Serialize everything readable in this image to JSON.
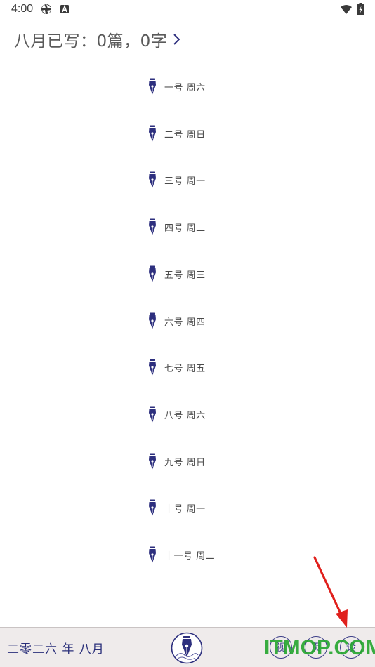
{
  "status_bar": {
    "time": "4:00",
    "icons": [
      "aperture-icon",
      "a-badge-icon",
      "wifi-icon",
      "battery-icon"
    ]
  },
  "header": {
    "title": "八月已写：0篇，0字",
    "chevron": "chevron-right-icon"
  },
  "days": [
    {
      "label": "一号 周六"
    },
    {
      "label": "二号 周日"
    },
    {
      "label": "三号 周一"
    },
    {
      "label": "四号 周二"
    },
    {
      "label": "五号 周三"
    },
    {
      "label": "六号 周四"
    },
    {
      "label": "七号 周五"
    },
    {
      "label": "八号 周六"
    },
    {
      "label": "九号 周日"
    },
    {
      "label": "十号 周一"
    },
    {
      "label": "十一号 周二"
    }
  ],
  "bottom_bar": {
    "date": "二零二六 年 八月",
    "buttons": [
      {
        "label": "视"
      },
      {
        "label": "页"
      },
      {
        "label": "设"
      }
    ]
  },
  "watermark": "ITMOP.COM",
  "colors": {
    "accent": "#3d3f88",
    "pen": "#2d2f7e",
    "bottom_bg": "#efebeb",
    "watermark": "#23a52d",
    "arrow": "#e0201c"
  }
}
